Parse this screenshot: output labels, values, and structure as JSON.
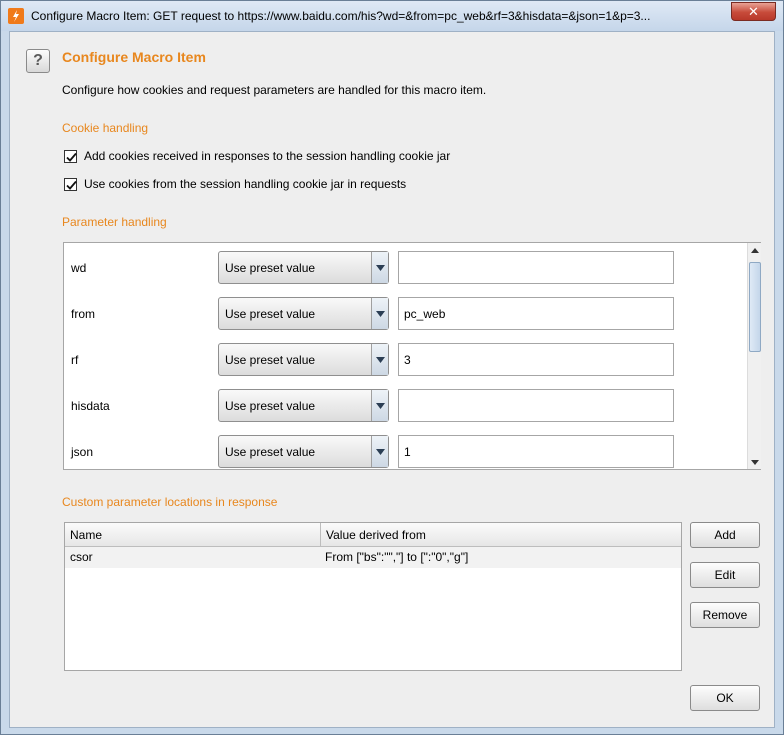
{
  "window": {
    "title": "Configure Macro Item: GET request to https://www.baidu.com/his?wd=&from=pc_web&rf=3&hisdata=&json=1&p=3...",
    "close_label": "✕"
  },
  "header": {
    "heading": "Configure Macro Item",
    "description": "Configure how cookies and request parameters are handled for this macro item."
  },
  "cookie_handling": {
    "heading": "Cookie handling",
    "options": [
      {
        "label": "Add cookies received in responses to the session handling cookie jar",
        "checked": true
      },
      {
        "label": "Use cookies from the session handling cookie jar in requests",
        "checked": true
      }
    ]
  },
  "parameter_handling": {
    "heading": "Parameter handling",
    "rows": [
      {
        "name": "wd",
        "mode": "Use preset value",
        "value": ""
      },
      {
        "name": "from",
        "mode": "Use preset value",
        "value": "pc_web"
      },
      {
        "name": "rf",
        "mode": "Use preset value",
        "value": "3"
      },
      {
        "name": "hisdata",
        "mode": "Use preset value",
        "value": ""
      },
      {
        "name": "json",
        "mode": "Use preset value",
        "value": "1"
      }
    ]
  },
  "custom_locations": {
    "heading": "Custom parameter locations in response",
    "columns": [
      "Name",
      "Value derived from"
    ],
    "rows": [
      {
        "name": "csor",
        "derived": "From [\"bs\":\"\",\"] to [\":\"0\",\"g\"]"
      }
    ],
    "buttons": {
      "add": "Add",
      "edit": "Edit",
      "remove": "Remove"
    }
  },
  "footer": {
    "ok": "OK"
  },
  "colors": {
    "accent": "#e8871e",
    "app_icon": "#f07a1a"
  }
}
